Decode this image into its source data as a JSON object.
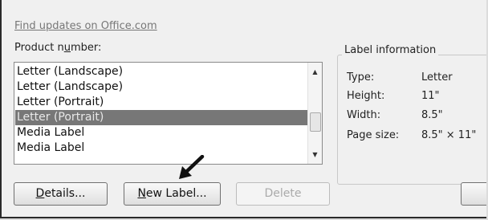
{
  "link": {
    "text": "Find updates on Office.com"
  },
  "product": {
    "label_prefix": "Product n",
    "label_accel": "u",
    "label_suffix": "mber:",
    "items": [
      {
        "text": "Letter (Landscape)",
        "selected": false
      },
      {
        "text": "Letter (Landscape)",
        "selected": false
      },
      {
        "text": "Letter (Portrait)",
        "selected": false
      },
      {
        "text": "Letter (Portrait)",
        "selected": true
      },
      {
        "text": "Media Label",
        "selected": false
      },
      {
        "text": "Media Label",
        "selected": false
      }
    ]
  },
  "label_info": {
    "title": "Label information",
    "rows": [
      {
        "key": "Type:",
        "value": "Letter"
      },
      {
        "key": "Height:",
        "value": "11\""
      },
      {
        "key": "Width:",
        "value": "8.5\""
      },
      {
        "key": "Page size:",
        "value": "8.5\" × 11\""
      }
    ]
  },
  "buttons": {
    "details": {
      "accel": "D",
      "rest": "etails..."
    },
    "new_label": {
      "accel": "N",
      "rest": "ew Label..."
    },
    "delete": {
      "text": "Delete"
    }
  },
  "icons": {
    "arrow": "pointer-arrow-icon",
    "scroll_up": "scroll-up-icon",
    "scroll_down": "scroll-down-icon"
  }
}
